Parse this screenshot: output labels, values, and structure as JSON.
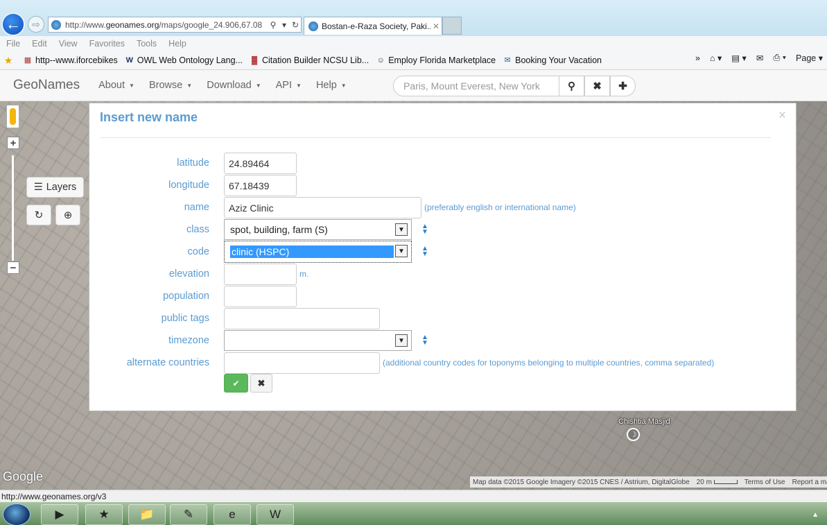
{
  "browser": {
    "address_url": "http://www.geonames.org/maps/google_24.906,67.08",
    "address_url_prefix": "http://www.",
    "address_url_domain": "geonames.org",
    "address_url_rest": "/maps/google_24.906,67.08",
    "tab_title": "Bostan-e-Raza Society, Paki...",
    "menu": [
      "File",
      "Edit",
      "View",
      "Favorites",
      "Tools",
      "Help"
    ],
    "favorites": [
      "http--www.iforcebikes",
      "OWL Web Ontology Lang...",
      "Citation Builder  NCSU Lib...",
      "Employ Florida Marketplace",
      "Booking Your Vacation"
    ],
    "toolbar_page_label": "Page",
    "chevron": "»",
    "status_url": "http://www.geonames.org/v3"
  },
  "geonames": {
    "brand": "GeoNames",
    "nav": [
      "About",
      "Browse",
      "Download",
      "API",
      "Help"
    ],
    "search_placeholder": "Paris, Mount Everest, New York"
  },
  "map": {
    "layers_label": "Layers",
    "poi_label": "Chishtia Masjid",
    "google_logo": "Google",
    "attribution": "Map data ©2015 Google Imagery ©2015 CNES / Astrium, DigitalGlobe",
    "scale": "20 m",
    "terms": "Terms of Use",
    "report": "Report a map error"
  },
  "modal": {
    "title": "Insert new name",
    "close": "×",
    "fields": {
      "latitude": {
        "label": "latitude",
        "value": "24.89464"
      },
      "longitude": {
        "label": "longitude",
        "value": "67.18439"
      },
      "name": {
        "label": "name",
        "value": "Aziz Clinic",
        "hint": "(preferably english or international name)"
      },
      "class": {
        "label": "class",
        "value": "spot, building, farm (S)"
      },
      "code": {
        "label": "code",
        "value": "clinic (HSPC)"
      },
      "elevation": {
        "label": "elevation",
        "value": "",
        "unit": "m."
      },
      "population": {
        "label": "population",
        "value": ""
      },
      "public_tags": {
        "label": "public tags",
        "value": ""
      },
      "timezone": {
        "label": "timezone",
        "value": ""
      },
      "alternate_countries": {
        "label": "alternate countries",
        "value": "",
        "hint": "(additional country codes for toponyms belonging to multiple countries, comma separated)"
      }
    }
  }
}
